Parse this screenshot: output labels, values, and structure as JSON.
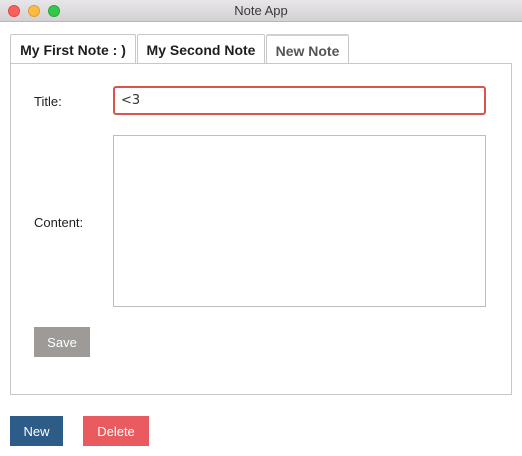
{
  "window": {
    "title": "Note App"
  },
  "tabs": [
    {
      "label": "My First Note : )"
    },
    {
      "label": "My Second Note"
    },
    {
      "label": "New Note",
      "selected": true
    }
  ],
  "form": {
    "title_label": "Title:",
    "title_value": "<3",
    "content_label": "Content:",
    "content_value": "",
    "save_label": "Save"
  },
  "actions": {
    "new_label": "New",
    "delete_label": "Delete"
  },
  "colors": {
    "title_input_border": "#d9534f",
    "save_button": "#9e9a97",
    "new_button": "#2d5c88",
    "delete_button": "#e95b5e"
  }
}
